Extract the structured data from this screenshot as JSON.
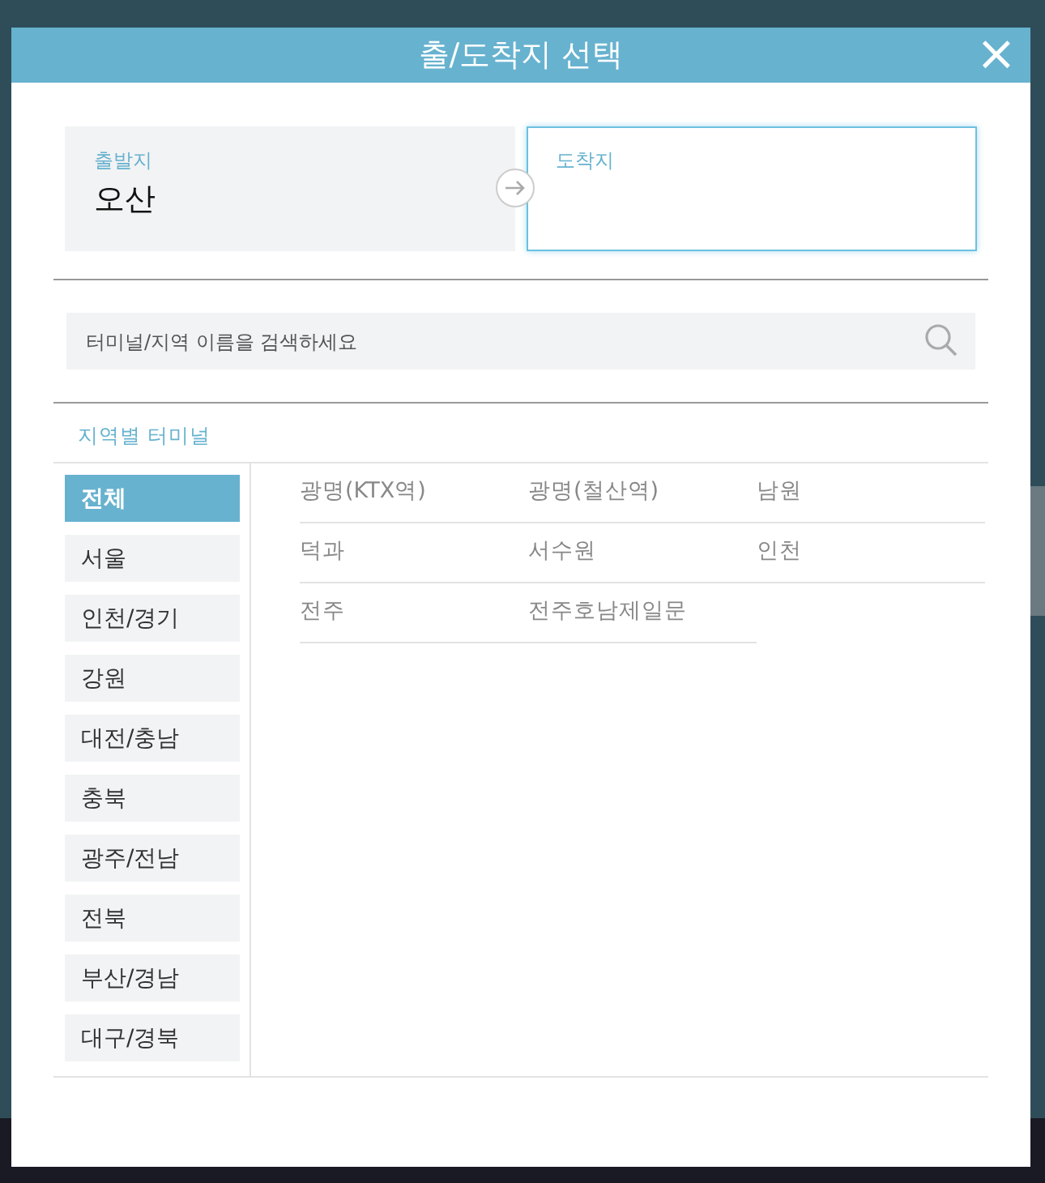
{
  "dialog": {
    "title": "출/도착지 선택",
    "close_icon": "×"
  },
  "route": {
    "departure": {
      "label": "출발지",
      "value": "오산",
      "active": false
    },
    "arrival": {
      "label": "도착지",
      "active": true
    }
  },
  "search": {
    "placeholder": "터미널/지역 이름을 검색하세요"
  },
  "section_title": "지역별 터미널",
  "regions": [
    {
      "label": "전체",
      "selected": true
    },
    {
      "label": "서울",
      "selected": false
    },
    {
      "label": "인천/경기",
      "selected": false
    },
    {
      "label": "강원",
      "selected": false
    },
    {
      "label": "대전/충남",
      "selected": false
    },
    {
      "label": "충북",
      "selected": false
    },
    {
      "label": "광주/전남",
      "selected": false
    },
    {
      "label": "전북",
      "selected": false
    },
    {
      "label": "부산/경남",
      "selected": false
    },
    {
      "label": "대구/경북",
      "selected": false
    }
  ],
  "terminals": [
    "광명(KTX역)",
    "광명(철산역)",
    "남원",
    "덕과",
    "서수원",
    "인천",
    "전주",
    "전주호남제일문"
  ]
}
